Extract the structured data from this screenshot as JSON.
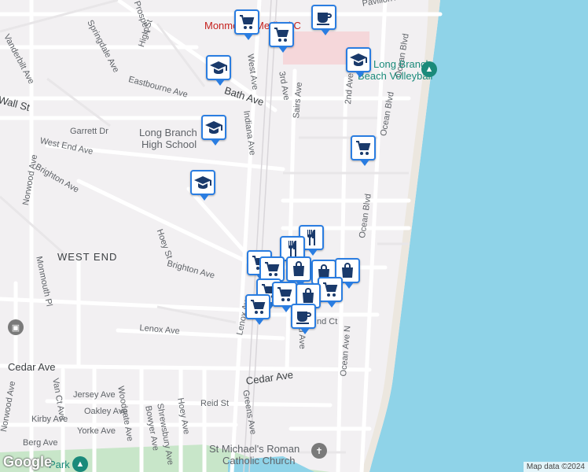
{
  "map": {
    "street_labels": [
      {
        "text": "Vanderbilt Ave"
      },
      {
        "text": "Springdale Ave"
      },
      {
        "text": "High St"
      },
      {
        "text": "Prospect"
      },
      {
        "text": "Eastbourne Ave"
      },
      {
        "text": "Wall St"
      },
      {
        "text": "Bath Ave"
      },
      {
        "text": "Garrett Dr"
      },
      {
        "text": "West End Ave"
      },
      {
        "text": "Brighton Ave"
      },
      {
        "text": "Norwood Ave"
      },
      {
        "text": "Hoey St"
      },
      {
        "text": "Monmouth Pl"
      },
      {
        "text": "Brighton Ave"
      },
      {
        "text": "Lenox Ave"
      },
      {
        "text": "Cedar Ave"
      },
      {
        "text": "Cedar Ave"
      },
      {
        "text": "Jersey Ave"
      },
      {
        "text": "Oakley Ave"
      },
      {
        "text": "Kirby Ave"
      },
      {
        "text": "Yorke Ave"
      },
      {
        "text": "Berg Ave"
      },
      {
        "text": "Van Ct Ave"
      },
      {
        "text": "Woodgate Ave"
      },
      {
        "text": "Bowyer Ave"
      },
      {
        "text": "Hoey Ave"
      },
      {
        "text": "Shrewsbury Ave"
      },
      {
        "text": "Reid St"
      },
      {
        "text": "Lenox Ave"
      },
      {
        "text": "Greens Ave"
      },
      {
        "text": "West Ave"
      },
      {
        "text": "Indiana Ave"
      },
      {
        "text": "3rd Ave"
      },
      {
        "text": "Sairs Ave"
      },
      {
        "text": "2nd Ave"
      },
      {
        "text": "2nd Ave"
      },
      {
        "text": "Ocean Blvd"
      },
      {
        "text": "Ocean Blvd"
      },
      {
        "text": "Ocean Ave N"
      },
      {
        "text": "Ocean Blvd"
      },
      {
        "text": "Pavilion Av"
      },
      {
        "text": "nd Ct"
      },
      {
        "text": "Norwood Ave"
      },
      {
        "text": "Park"
      }
    ],
    "area_labels": [
      {
        "text": "WEST END"
      }
    ],
    "poi_labels": [
      {
        "text": "Long Branch"
      },
      {
        "text": "High School"
      },
      {
        "text": "Long Branch"
      },
      {
        "text": "Beach Volleyball"
      },
      {
        "text": "Monmouth Medical C"
      },
      {
        "text": "St Michael's Roman"
      },
      {
        "text": "Catholic Church"
      }
    ],
    "markers": [
      {
        "icon": "cart-icon"
      },
      {
        "icon": "cart-icon"
      },
      {
        "icon": "coffee-icon"
      },
      {
        "icon": "school-icon"
      },
      {
        "icon": "school-icon"
      },
      {
        "icon": "school-icon"
      },
      {
        "icon": "school-icon"
      },
      {
        "icon": "cart-icon"
      },
      {
        "icon": "restaurant-icon"
      },
      {
        "icon": "restaurant-icon"
      },
      {
        "icon": "cart-icon"
      },
      {
        "icon": "cart-icon"
      },
      {
        "icon": "bag-icon"
      },
      {
        "icon": "bag-icon"
      },
      {
        "icon": "bag-icon"
      },
      {
        "icon": "cart-icon"
      },
      {
        "icon": "cart-icon"
      },
      {
        "icon": "bag-icon"
      },
      {
        "icon": "cart-icon"
      },
      {
        "icon": "cart-icon"
      },
      {
        "icon": "coffee-icon"
      }
    ],
    "attribution": "Map data ©2024",
    "logo": "Google",
    "colors": {
      "water": "#8fd3e8",
      "land": "#f2f0f2",
      "road": "#ffffff",
      "marker_border": "#2a7de1",
      "marker_icon": "#1a3a6b",
      "park": "#c8e6c9"
    }
  }
}
